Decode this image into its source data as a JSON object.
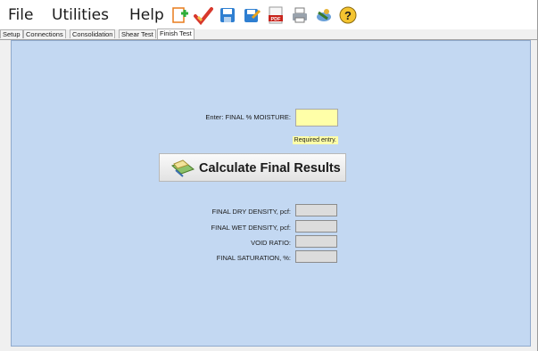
{
  "menu": {
    "file": "File",
    "utilities": "Utilities",
    "help": "Help"
  },
  "toolbar": {
    "icons": [
      "new-document-icon",
      "check-icon",
      "save-icon",
      "save-as-icon",
      "pdf-icon",
      "print-icon",
      "tools-icon",
      "help-icon"
    ],
    "pdf_badge": "PDF",
    "help_glyph": "?"
  },
  "tabs": [
    {
      "label": "Setup"
    },
    {
      "label": "Connections"
    },
    {
      "label": "Consolidation"
    },
    {
      "label": "Shear Test"
    },
    {
      "label": "Finish Test",
      "active": true
    }
  ],
  "form": {
    "moisture_label": "Enter: FINAL % MOISTURE:",
    "moisture_value": "",
    "required_note": "Required entry.",
    "calculate_label": "Calculate Final Results",
    "results": [
      {
        "label": "FINAL DRY DENSITY, pcf:",
        "value": ""
      },
      {
        "label": "FINAL WET DENSITY, pcf:",
        "value": ""
      },
      {
        "label": "VOID RATIO:",
        "value": ""
      },
      {
        "label": "FINAL SATURATION, %:",
        "value": ""
      }
    ]
  },
  "colors": {
    "panel_bg": "#c3d8f2",
    "required_bg": "#ffffa8",
    "readonly_bg": "#dcdcdc"
  }
}
